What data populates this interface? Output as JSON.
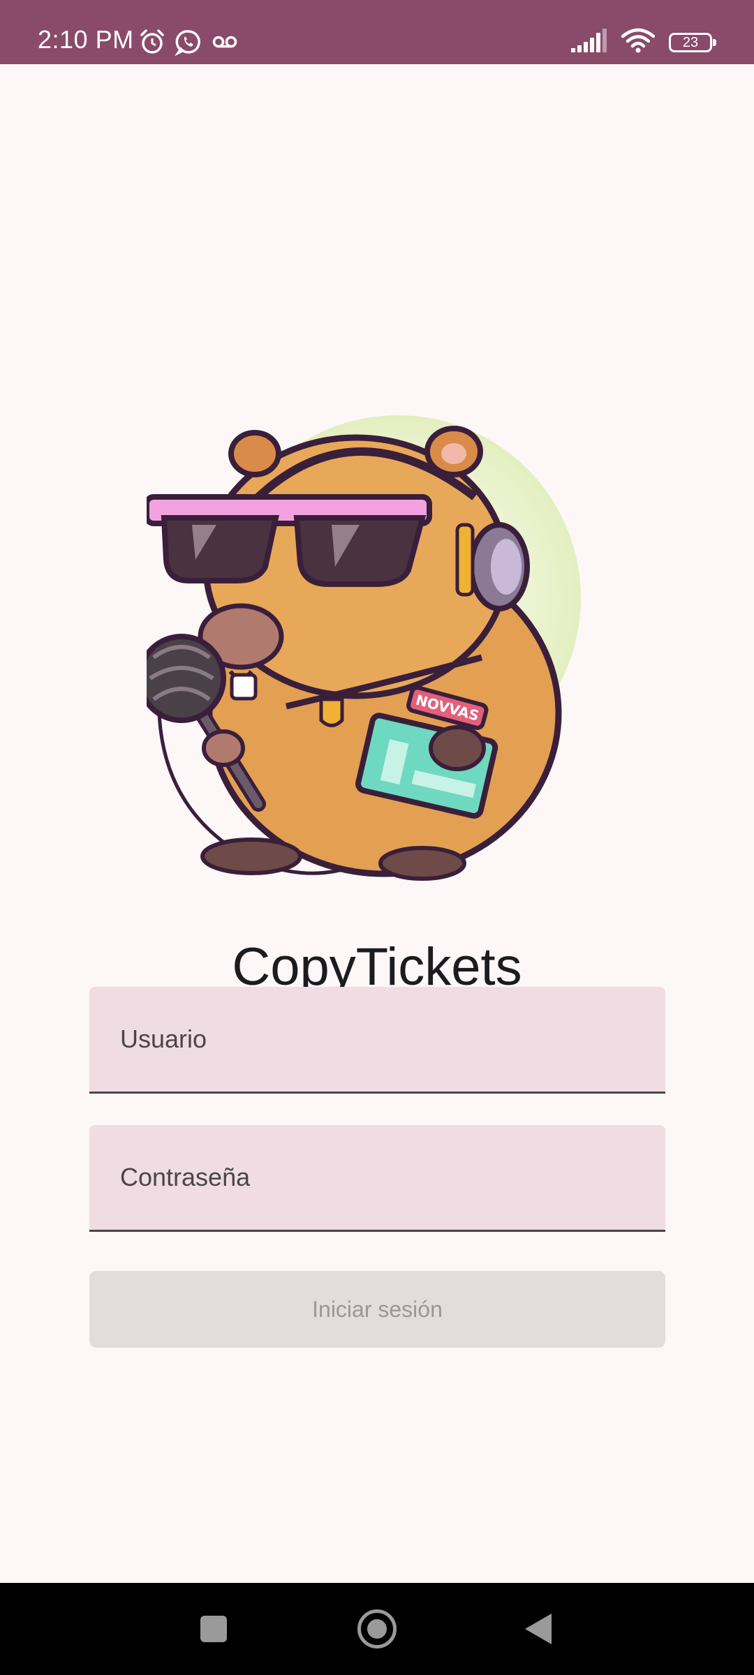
{
  "status_bar": {
    "time": "2:10 PM",
    "battery_level": "23",
    "background_color": "#8a4a6a",
    "left_icons": [
      "alarm-icon",
      "whatsapp-icon",
      "voicemail-icon"
    ],
    "right_icons": [
      "signal-icon",
      "wifi-icon",
      "battery-icon"
    ]
  },
  "logo": {
    "description_icon": "capybara-dj-logo",
    "ticket_band_text": "NOVVAS"
  },
  "app": {
    "title": "CopyTickets"
  },
  "form": {
    "username_placeholder": "Usuario",
    "username_value": "",
    "password_placeholder": "Contraseña",
    "password_value": "",
    "login_button_label": "Iniciar sesión",
    "login_button_enabled": false
  },
  "nav_bar": {
    "buttons": [
      "recent-apps-button",
      "home-button",
      "back-button"
    ]
  }
}
